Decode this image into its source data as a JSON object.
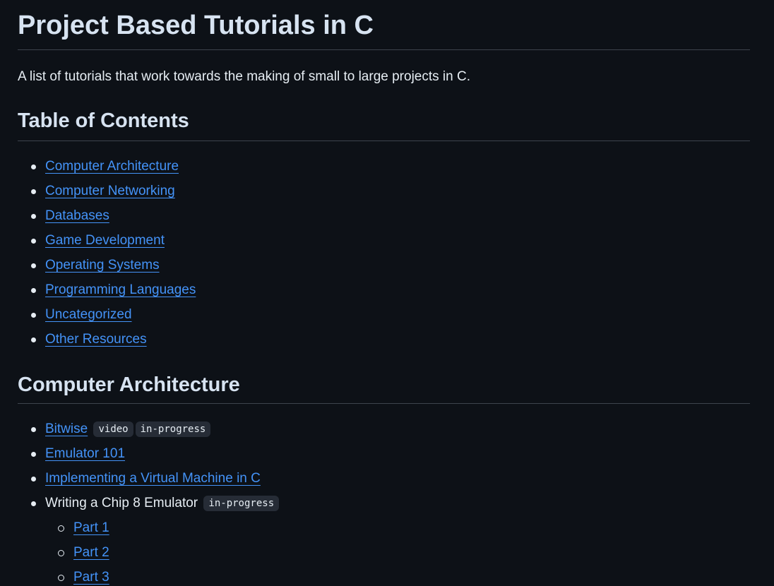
{
  "page": {
    "title": "Project Based Tutorials in C",
    "intro": "A list of tutorials that work towards the making of small to large projects in C."
  },
  "toc": {
    "heading": "Table of Contents",
    "items": [
      {
        "label": "Computer Architecture"
      },
      {
        "label": "Computer Networking"
      },
      {
        "label": "Databases"
      },
      {
        "label": "Game Development"
      },
      {
        "label": "Operating Systems"
      },
      {
        "label": "Programming Languages"
      },
      {
        "label": "Uncategorized"
      },
      {
        "label": "Other Resources"
      }
    ]
  },
  "computer_architecture": {
    "heading": "Computer Architecture",
    "items": [
      {
        "label": "Bitwise",
        "tags": [
          "video",
          "in-progress"
        ]
      },
      {
        "label": "Emulator 101",
        "tags": []
      },
      {
        "label": "Implementing a Virtual Machine in C",
        "tags": []
      },
      {
        "label": "Writing a Chip 8 Emulator",
        "tags": [
          "in-progress"
        ],
        "subitems": [
          {
            "label": "Part 1"
          },
          {
            "label": "Part 2"
          },
          {
            "label": "Part 3"
          }
        ]
      }
    ]
  },
  "colors": {
    "background": "#0d1117",
    "text": "#e6edf3",
    "link": "#4493f8",
    "code_background": "#262c36",
    "divider": "#3d444d"
  }
}
